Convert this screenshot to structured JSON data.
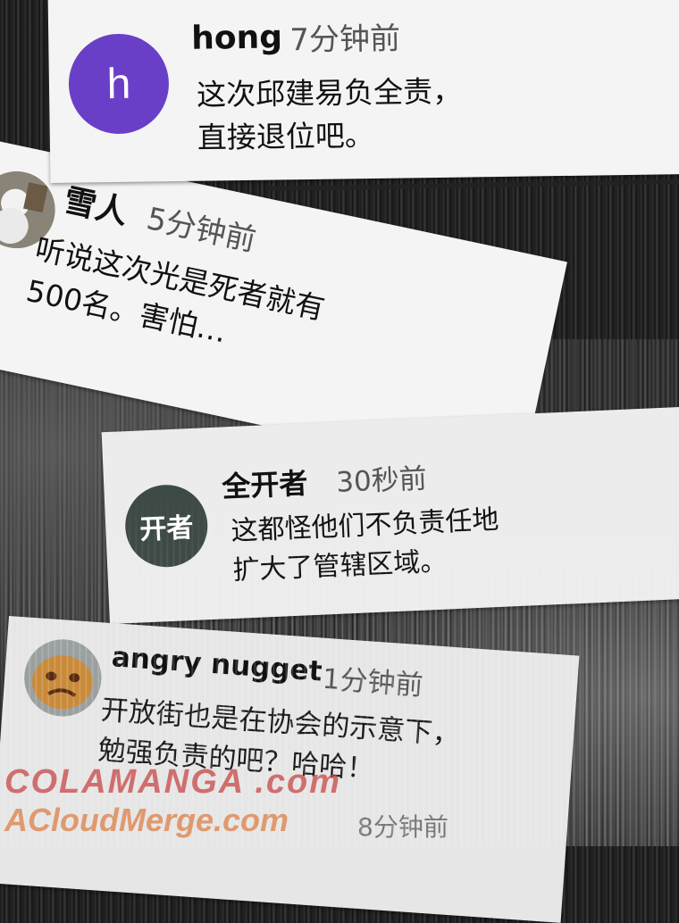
{
  "comments": [
    {
      "avatar_letter": "h",
      "avatar_color": "#6a3fc8",
      "user": "hong",
      "time": "7分钟前",
      "text": "这次邱建易负全责，\n直接退位吧。"
    },
    {
      "avatar_letter": "",
      "avatar_color": "#8a8478",
      "user": "雪人",
      "time": "5分钟前",
      "text": "听说这次光是死者就有\n500名。害怕…"
    },
    {
      "avatar_letter": "开者",
      "avatar_color": "#3e4a46",
      "user": "全开者",
      "time": "30秒前",
      "text": "这都怪他们不负责任地\n扩大了管辖区域。"
    },
    {
      "avatar_letter": "",
      "avatar_color": "#b07830",
      "user": "angry nugget",
      "time": "1分钟前",
      "text": "开放街也是在协会的示意下，\n勉强负责的吧？哈哈！"
    }
  ],
  "partial_time": "8分钟前",
  "watermark": {
    "line1": "COLAMANGA .com",
    "line2": "ACloudMerge.com"
  }
}
